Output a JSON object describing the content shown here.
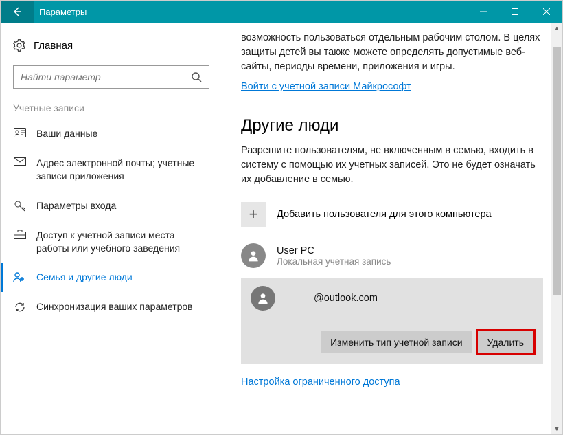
{
  "titlebar": {
    "title": "Параметры"
  },
  "sidebar": {
    "home": "Главная",
    "search_placeholder": "Найти параметр",
    "section": "Учетные записи",
    "items": [
      {
        "label": "Ваши данные"
      },
      {
        "label": "Адрес электронной почты; учетные записи приложения"
      },
      {
        "label": "Параметры входа"
      },
      {
        "label": "Доступ к учетной записи места работы или учебного заведения"
      },
      {
        "label": "Семья и другие люди"
      },
      {
        "label": "Синхронизация ваших параметров"
      }
    ]
  },
  "main": {
    "intro": "возможность пользоваться отдельным рабочим столом. В целях защиты детей вы также можете определять допустимые веб-сайты, периоды времени, приложения и игры.",
    "signin_link": "Войти с учетной записи Майкрософт",
    "section_title": "Другие люди",
    "section_desc": "Разрешите пользователям, не включенным в семью, входить в систему с помощью их учетных записей. Это не будет означать их добавление в семью.",
    "add_user": "Добавить пользователя для этого компьютера",
    "users": [
      {
        "name": "User PC",
        "type": "Локальная учетная запись"
      },
      {
        "name": "@outlook.com",
        "type": ""
      }
    ],
    "change_type_btn": "Изменить тип учетной записи",
    "delete_btn": "Удалить",
    "restricted_link": "Настройка ограниченного доступа"
  }
}
